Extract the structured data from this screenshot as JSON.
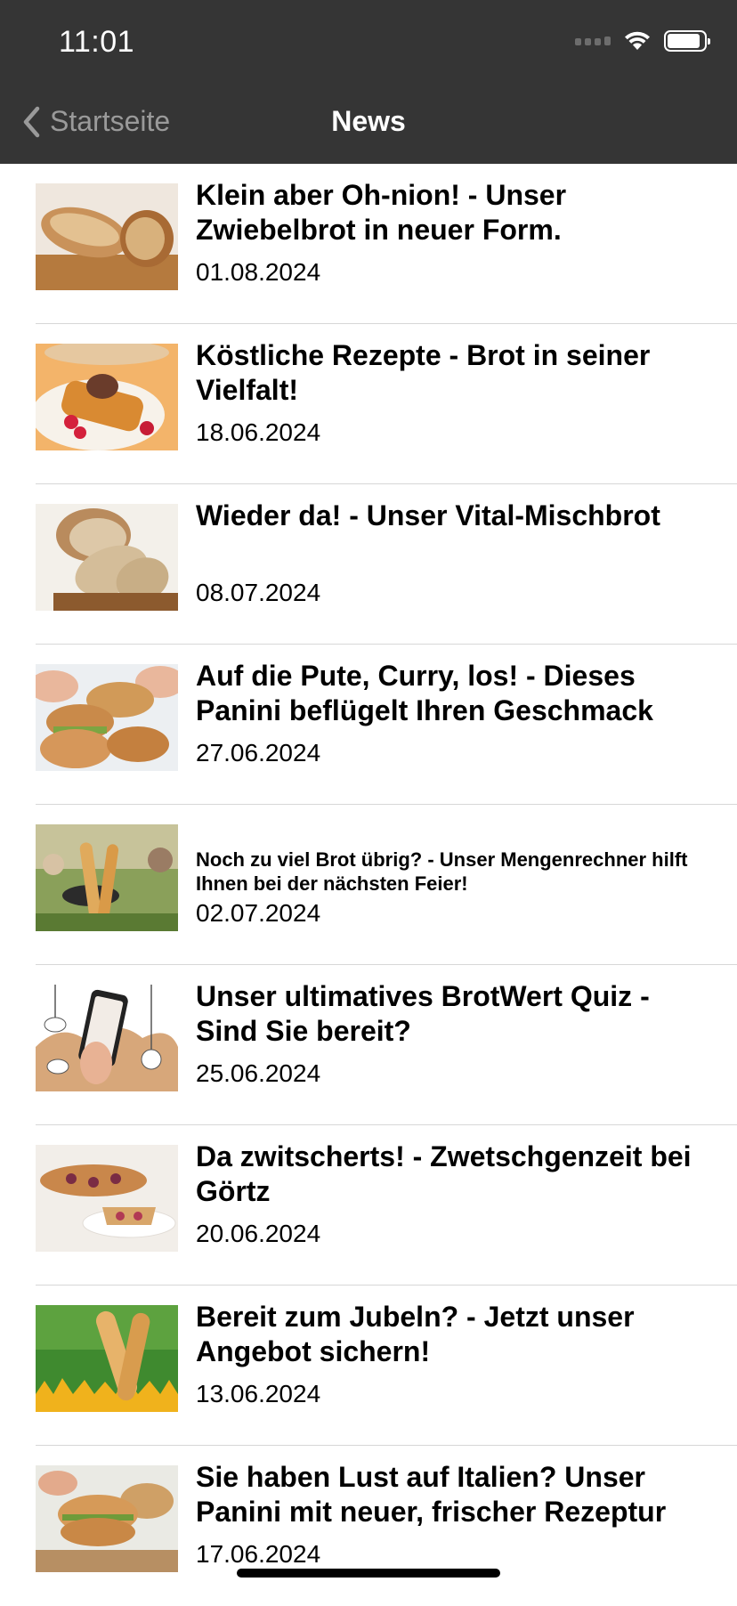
{
  "status_bar": {
    "time": "11:01",
    "icons": [
      "signal-icon",
      "wifi-icon",
      "battery-icon"
    ]
  },
  "nav": {
    "back_label": "Startseite",
    "title": "News"
  },
  "news": [
    {
      "title": "Klein aber Oh-nion! - Unser Zwiebelbrot in neuer Form.",
      "date": "01.08.2024",
      "thumb": "zwiebelbrot-image"
    },
    {
      "title": "Köstliche Rezepte - Brot in seiner Vielfalt!",
      "date": "18.06.2024",
      "thumb": "french-toast-image"
    },
    {
      "title": "Wieder da! - Unser Vital-Mischbrot",
      "date": "08.07.2024",
      "thumb": "mischbrot-image"
    },
    {
      "title": "Auf die Pute, Curry, los! - Dieses Panini beflügelt Ihren Geschmack",
      "date": "27.06.2024",
      "thumb": "panini-image"
    },
    {
      "title": "Noch zu viel Brot übrig? - Unser Mengenrechner hilft Ihnen bei der nächsten Feier!",
      "date": "02.07.2024",
      "thumb": "grill-baguette-image"
    },
    {
      "title": "Unser ultimatives BrotWert Quiz - Sind Sie bereit?",
      "date": "25.06.2024",
      "thumb": "quiz-phone-image"
    },
    {
      "title": "Da zwitscherts! - Zwetschgenzeit bei Görtz",
      "date": "20.06.2024",
      "thumb": "zwetschgen-cake-image"
    },
    {
      "title": "Bereit zum Jubeln? - Jetzt unser Angebot sichern!",
      "date": "13.06.2024",
      "thumb": "baguette-field-image"
    },
    {
      "title": "Sie haben Lust auf Italien? Unser Panini mit neuer, frischer Rezeptur",
      "date": "17.06.2024",
      "thumb": "italian-panini-image"
    }
  ],
  "colors": {
    "nav_bg": "#353535",
    "back_text": "#9a9a9a",
    "divider": "#d7d7d7"
  }
}
